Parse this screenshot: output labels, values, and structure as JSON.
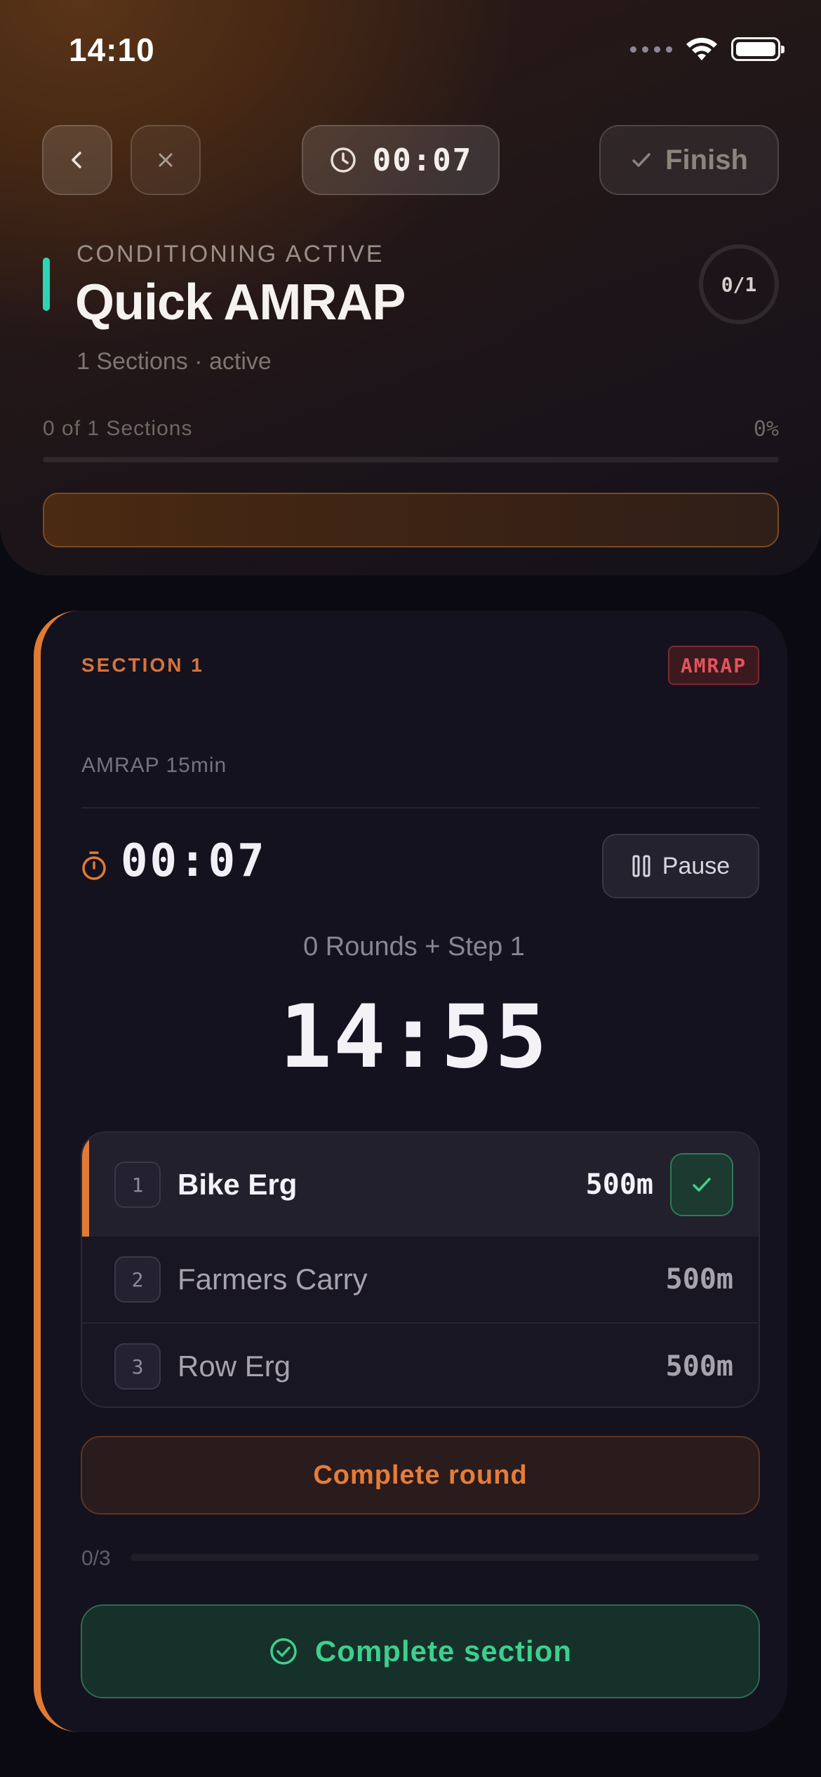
{
  "status_bar": {
    "time": "14:10",
    "icons": [
      "signal-dots-icon",
      "wifi-icon",
      "battery-icon"
    ]
  },
  "header": {
    "timer": "00:07",
    "finish_label": "Finish",
    "eyebrow": "CONDITIONING ACTIVE",
    "title": "Quick AMRAP",
    "meta": "1 Sections ·  active",
    "ring_text": "0/1",
    "progress_label": "0 of 1 Sections",
    "progress_pct": "0%",
    "progress_value": 0
  },
  "section": {
    "label": "SECTION 1",
    "badge": "AMRAP",
    "description": "AMRAP 15min",
    "elapsed": "00:07",
    "pause_label": "Pause",
    "rounds_text": "0 Rounds + Step 1",
    "remaining": "14:55",
    "exercises": [
      {
        "num": "1",
        "name": "Bike Erg",
        "value": "500m",
        "active": true
      },
      {
        "num": "2",
        "name": "Farmers Carry",
        "value": "500m",
        "active": false
      },
      {
        "num": "3",
        "name": "Row Erg",
        "value": "500m",
        "active": false
      }
    ],
    "complete_round_label": "Complete round",
    "round_progress_label": "0/3",
    "round_progress_value": 0,
    "complete_section_label": "Complete section"
  },
  "colors": {
    "accent": "#e07b35",
    "success": "#3ecf8e",
    "teal": "#2dd4b6",
    "danger": "#e2545b"
  }
}
